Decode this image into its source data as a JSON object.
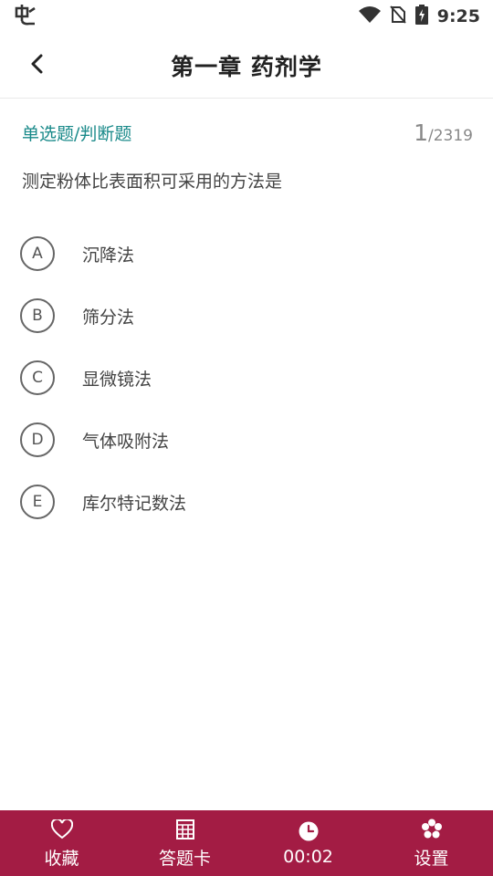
{
  "status_bar": {
    "time": "9:25",
    "icons": [
      "app-logo-icon",
      "wifi-icon",
      "no-sim-icon",
      "battery-charging-icon"
    ]
  },
  "header": {
    "title": "第一章 药剂学",
    "back_icon": "chevron-left-icon"
  },
  "question": {
    "type_label": "单选题/判断题",
    "current": "1",
    "separator": "/",
    "total": "2319",
    "text": "测定粉体比表面积可采用的方法是",
    "options": [
      {
        "letter": "A",
        "text": "沉降法"
      },
      {
        "letter": "B",
        "text": "筛分法"
      },
      {
        "letter": "C",
        "text": "显微镜法"
      },
      {
        "letter": "D",
        "text": "气体吸附法"
      },
      {
        "letter": "E",
        "text": "库尔特记数法"
      }
    ]
  },
  "bottom_bar": {
    "background": "#a31c44",
    "tabs": [
      {
        "icon": "heart-icon",
        "label": "收藏"
      },
      {
        "icon": "grid-card-icon",
        "label": "答题卡"
      },
      {
        "icon": "clock-icon",
        "label": "00:02"
      },
      {
        "icon": "gear-icon",
        "label": "设置"
      }
    ]
  },
  "colors": {
    "accent_teal": "#1a8a8a",
    "brand": "#a31c44"
  }
}
